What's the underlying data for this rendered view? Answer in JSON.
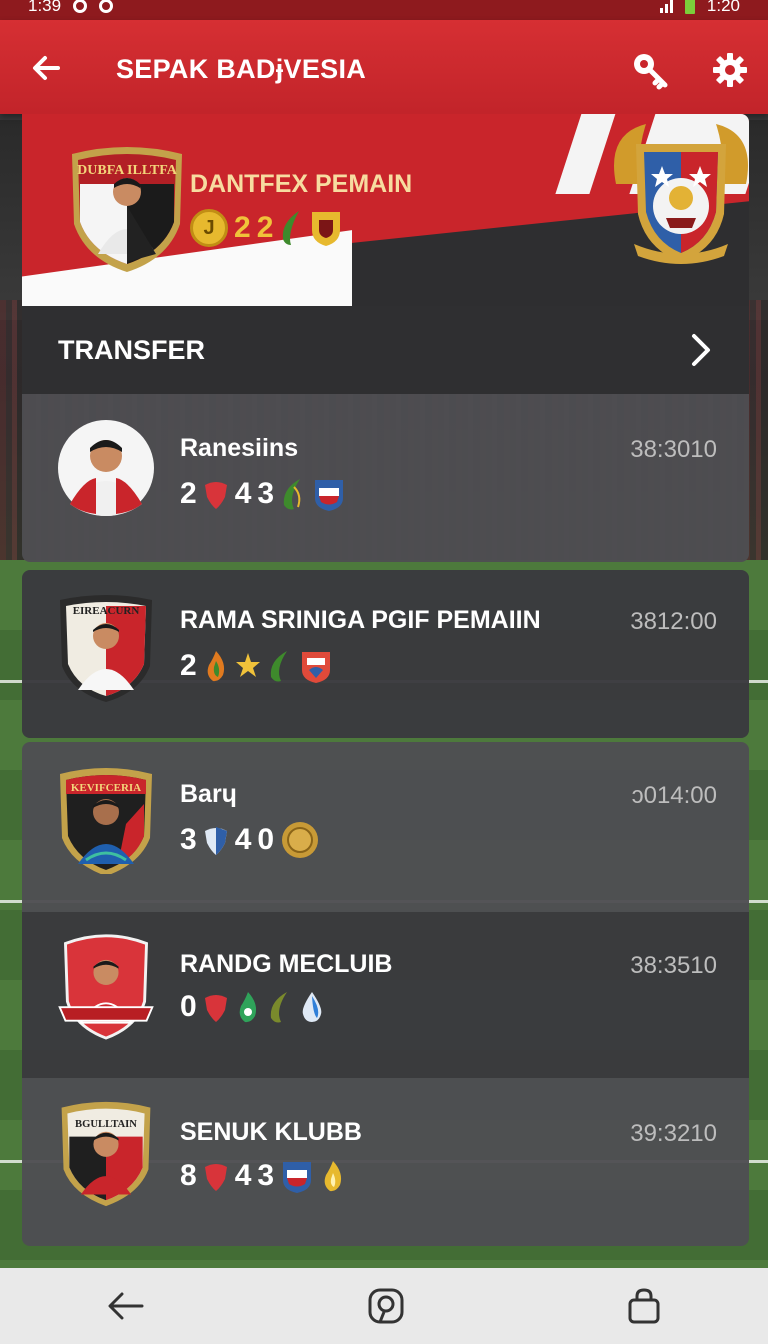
{
  "status_bar": {
    "time_left": "1:39",
    "time_right": "1:20"
  },
  "app_bar": {
    "title": "SEPAK BADɉVESIA",
    "icons": [
      "back-arrow-icon",
      "search-key-icon",
      "gear-icon"
    ]
  },
  "hero": {
    "badge_text": "DUBFA ILLTFA",
    "title": "DANTFEX PEMAIN",
    "stats": [
      "2",
      "2"
    ],
    "coin_text": "J"
  },
  "transfer": {
    "label": "TRANSFER"
  },
  "players": [
    {
      "name": "Ranesiins",
      "time": "38:3010",
      "stats": [
        "2",
        "4",
        "3"
      ],
      "badge_text": ""
    },
    {
      "name": "RAMA SRINIGA PGIF PEMAIIN",
      "time": "3812:00",
      "stats": [
        "2"
      ],
      "badge_text": "EIREACURN"
    },
    {
      "name": "Barɥ",
      "time": "ɔ014:00",
      "stats": [
        "3",
        "4",
        "0"
      ],
      "badge_text": "KEVIFCERIA"
    },
    {
      "name": "RANDG MECLUIB",
      "time": "38:3510",
      "stats": [
        "0"
      ],
      "badge_text": ""
    },
    {
      "name": "SENUK KLUBB",
      "time": "39:3210",
      "stats": [
        "8",
        "4",
        "3"
      ],
      "badge_text": "BGULLTAIN"
    }
  ],
  "nav_bar": {
    "icons": [
      "back-nav-icon",
      "home-nav-icon",
      "recents-nav-icon"
    ]
  },
  "colors": {
    "primary_red": "#c9252b",
    "app_bar_red": "#d62f33",
    "card_dark": "#2f2f31",
    "card_row": "#4e4e52",
    "gold": "#e7b92e"
  }
}
